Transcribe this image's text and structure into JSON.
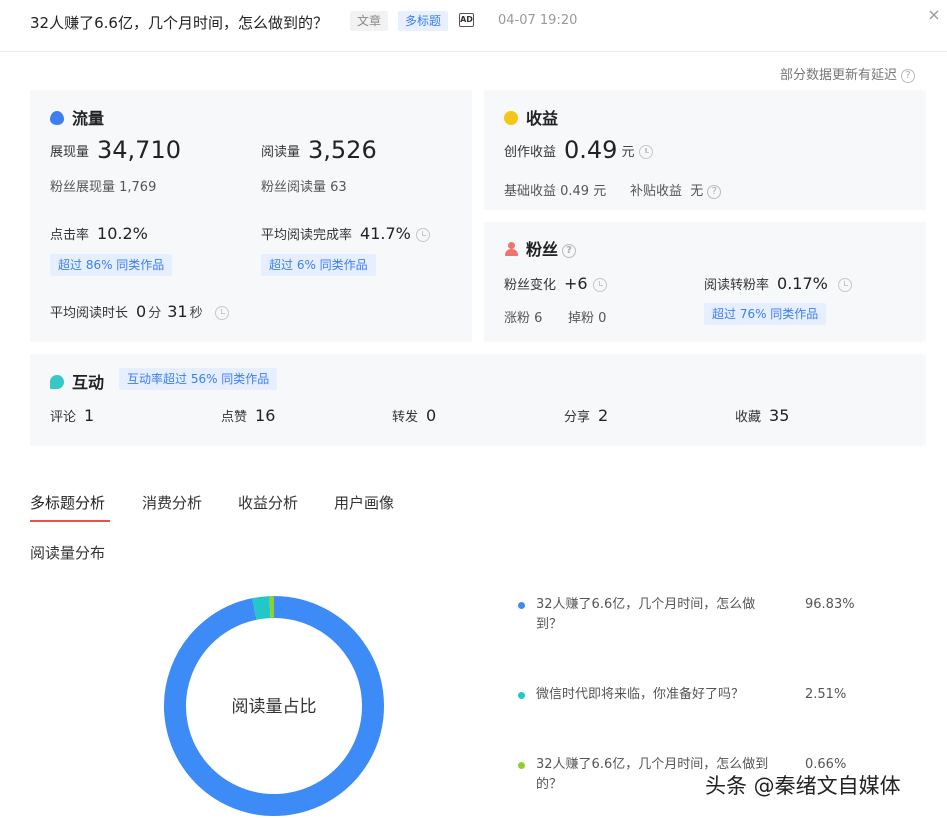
{
  "header": {
    "title": "32人赚了6.6亿，几个月时间，怎么做到的？",
    "tag_article": "文章",
    "tag_multi": "多标题",
    "ad_icon": "AD",
    "time": "04-07 19:20",
    "close": "×"
  },
  "delay_note": "部分数据更新有延迟",
  "traffic": {
    "title": "流量",
    "impressions_label": "展现量",
    "impressions_value": "34,710",
    "reads_label": "阅读量",
    "reads_value": "3,526",
    "fan_impressions": "粉丝展现量 1,769",
    "fan_reads": "粉丝阅读量 63",
    "ctr_label": "点击率",
    "ctr_value": "10.2%",
    "ctr_badge": "超过 86% 同类作品",
    "completion_label": "平均阅读完成率",
    "completion_value": "41.7%",
    "completion_badge": "超过 6% 同类作品",
    "duration_label": "平均阅读时长",
    "duration_min": "0",
    "duration_min_unit": "分",
    "duration_sec": "31",
    "duration_sec_unit": "秒"
  },
  "income": {
    "title": "收益",
    "creation_label": "创作收益",
    "creation_value": "0.49",
    "creation_unit": "元",
    "base_income": "基础收益 0.49 元",
    "subsidy_label": "补贴收益",
    "subsidy_value": "无"
  },
  "fans": {
    "title": "粉丝",
    "change_label": "粉丝变化",
    "change_value": "+6",
    "gain": "涨粉 6",
    "loss": "掉粉 0",
    "conversion_label": "阅读转粉率",
    "conversion_value": "0.17%",
    "conversion_badge": "超过 76% 同类作品"
  },
  "interaction": {
    "title": "互动",
    "badge": "互动率超过 56% 同类作品",
    "comments_label": "评论",
    "comments_value": "1",
    "likes_label": "点赞",
    "likes_value": "16",
    "reposts_label": "转发",
    "reposts_value": "0",
    "shares_label": "分享",
    "shares_value": "2",
    "favorites_label": "收藏",
    "favorites_value": "35"
  },
  "tabs": [
    "多标题分析",
    "消费分析",
    "收益分析",
    "用户画像"
  ],
  "section_title": "阅读量分布",
  "chart_data": {
    "type": "pie",
    "center_label": "阅读量占比",
    "categories": [
      "32人赚了6.6亿，几个月时间，怎么做到？",
      "微信时代即将来临，你准备好了吗？",
      "32人赚了6.6亿，几个月时间，怎么做到的？"
    ],
    "values": [
      96.83,
      2.51,
      0.66
    ],
    "value_labels": [
      "96.83%",
      "2.51%",
      "0.66%"
    ],
    "colors": [
      "#3d8bf7",
      "#22c7c7",
      "#8ed12f"
    ],
    "legend_placement": "right"
  },
  "watermark": "头条 @秦绪文自媒体"
}
